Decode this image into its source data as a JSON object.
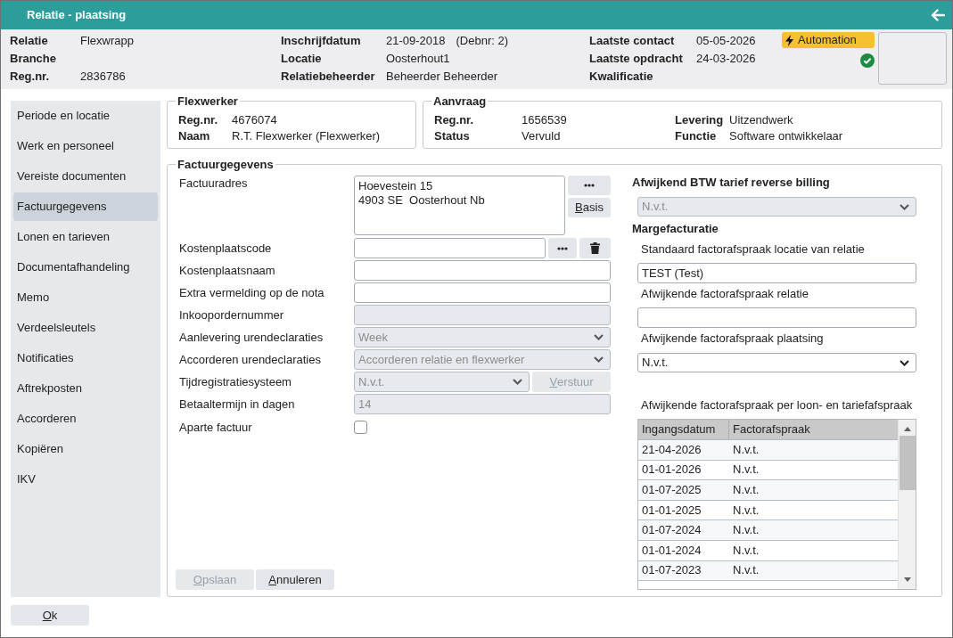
{
  "window": {
    "title": "Relatie - plaatsing"
  },
  "header": {
    "columns": [
      [
        {
          "label": "Relatie",
          "value": "Flexwrapp"
        },
        {
          "label": "Branche"
        },
        {
          "label": "Reg.nr.",
          "value": "2836786"
        }
      ],
      [
        {
          "label": "Inschrijfdatum",
          "value": "21-09-2018",
          "note": "(Debnr: 2)"
        },
        {
          "label": "Locatie",
          "value": "Oosterhout1"
        },
        {
          "label": "Relatiebeheerder",
          "value": "Beheerder Beheerder"
        }
      ],
      [
        {
          "label": "Laatste contact",
          "value": "05-05-2026"
        },
        {
          "label": "Laatste opdracht",
          "value": "24-03-2026"
        },
        {
          "label": "Kwalificatie"
        }
      ]
    ],
    "badge": {
      "label": "Automation"
    },
    "verified": true
  },
  "sidebar": {
    "items": [
      {
        "label": "Periode en locatie",
        "selected": false
      },
      {
        "label": "Werk en personeel",
        "selected": false
      },
      {
        "label": "Vereiste documenten",
        "selected": false
      },
      {
        "label": "Factuurgegevens",
        "selected": true
      },
      {
        "label": "Lonen en tarieven",
        "selected": false
      },
      {
        "label": "Documentafhandeling",
        "selected": false
      },
      {
        "label": "Memo",
        "selected": false
      },
      {
        "label": "Verdeelsleutels",
        "selected": false
      },
      {
        "label": "Notificaties",
        "selected": false
      },
      {
        "label": "Aftrekposten",
        "selected": false
      },
      {
        "label": "Accorderen",
        "selected": false
      },
      {
        "label": "Kopiëren",
        "selected": false
      },
      {
        "label": "IKV",
        "selected": false
      }
    ]
  },
  "flexwerker": {
    "title": "Flexwerker",
    "fields": [
      {
        "label": "Reg.nr.",
        "value": "4676074"
      },
      {
        "label": "Naam",
        "value": "R.T. Flexwerker (Flexwerker)"
      }
    ]
  },
  "aanvraag": {
    "title": "Aanvraag",
    "columns": [
      [
        {
          "label": "Reg.nr.",
          "value": "1656539"
        },
        {
          "label": "Status",
          "value": "Vervuld"
        }
      ],
      [
        {
          "label": "Levering",
          "value": "Uitzendwerk"
        },
        {
          "label": "Functie",
          "value": "Software ontwikkelaar"
        }
      ]
    ]
  },
  "factuurgegevens": {
    "title": "Factuurgegevens",
    "fields": [
      {
        "kind": "textarea",
        "label": "Factuuradres",
        "value": "Hoevestein 15\n4903 SE  Oosterhout Nb",
        "disabled": false,
        "actions": [
          {
            "kind": "more",
            "disabled": false
          },
          {
            "kind": "text",
            "label": "Basis",
            "disabled": false
          }
        ]
      },
      {
        "kind": "input",
        "label": "Kostenplaatscode",
        "disabled": false,
        "actions": [
          {
            "kind": "more",
            "disabled": false
          },
          {
            "kind": "delete",
            "disabled": false
          }
        ]
      },
      {
        "kind": "input",
        "label": "Kostenplaatsnaam",
        "disabled": false
      },
      {
        "kind": "input",
        "label": "Extra vermelding op de nota",
        "disabled": false
      },
      {
        "kind": "input",
        "label": "Inkoopordernummer",
        "disabled": true
      },
      {
        "kind": "select",
        "label": "Aanlevering urendeclaraties",
        "value": "Week",
        "disabled": true
      },
      {
        "kind": "select",
        "label": "Accorderen urendeclaraties",
        "value": "Accorderen relatie en flexwerker",
        "disabled": true
      },
      {
        "kind": "select",
        "label": "Tijdregistratiesysteem",
        "value": "N.v.t.",
        "disabled": true,
        "actions": [
          {
            "kind": "text",
            "label": "Verstuur",
            "disabled": true
          }
        ]
      },
      {
        "kind": "input",
        "label": "Betaaltermijn in dagen",
        "value": "14",
        "disabled": true
      },
      {
        "kind": "checkbox",
        "label": "Aparte factuur",
        "checked": false
      }
    ],
    "buttons": [
      {
        "label": "Opslaan",
        "disabled": true
      },
      {
        "label": "Annuleren",
        "disabled": false
      }
    ],
    "btw": {
      "title": "Afwijkend BTW tarief reverse billing",
      "value": "N.v.t.",
      "disabled": true
    },
    "margefacturatie": {
      "title": "Margefacturatie",
      "fields": [
        {
          "kind": "input",
          "label": "Standaard factorafspraak locatie van relatie",
          "value": "TEST (Test)",
          "disabled": false
        },
        {
          "kind": "input",
          "label": "Afwijkende factorafspraak relatie",
          "disabled": false
        },
        {
          "kind": "select",
          "label": "Afwijkende factorafspraak plaatsing",
          "value": "N.v.t.",
          "disabled": false
        }
      ]
    },
    "table": {
      "title": "Afwijkende factorafspraak per loon- en tariefafspraak",
      "columns": [
        "Ingangsdatum",
        "Factorafspraak"
      ],
      "rows": [
        [
          "21-04-2026",
          "N.v.t."
        ],
        [
          "01-01-2026",
          "N.v.t."
        ],
        [
          "01-07-2025",
          "N.v.t."
        ],
        [
          "01-01-2025",
          "N.v.t."
        ],
        [
          "01-07-2024",
          "N.v.t."
        ],
        [
          "01-01-2024",
          "N.v.t."
        ],
        [
          "01-07-2023",
          "N.v.t."
        ]
      ]
    }
  },
  "footer": {
    "buttons": [
      {
        "label": "Ok",
        "disabled": false
      }
    ]
  }
}
